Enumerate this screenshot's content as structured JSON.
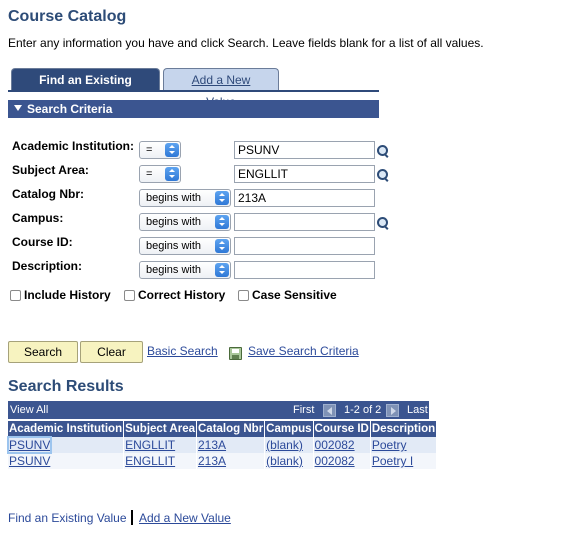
{
  "page": {
    "title": "Course Catalog",
    "instructions": "Enter any information you have and click Search. Leave fields blank for a list of all values."
  },
  "tabs": [
    {
      "label": "Find an Existing Value",
      "active": true
    },
    {
      "label": "Add a New Value",
      "active": false
    }
  ],
  "criteria": {
    "header": "Search Criteria",
    "fields": [
      {
        "label": "Academic Institution:",
        "operator": "=",
        "value": "PSUNV",
        "lookup": true
      },
      {
        "label": "Subject Area:",
        "operator": "=",
        "value": "ENGLLIT",
        "lookup": true
      },
      {
        "label": "Catalog Nbr:",
        "operator": "begins with",
        "value": "213A",
        "lookup": false
      },
      {
        "label": "Campus:",
        "operator": "begins with",
        "value": "",
        "lookup": true
      },
      {
        "label": "Course ID:",
        "operator": "begins with",
        "value": "",
        "lookup": false
      },
      {
        "label": "Description:",
        "operator": "begins with",
        "value": "",
        "lookup": false
      }
    ],
    "checkboxes": [
      {
        "label": "Include History",
        "checked": false
      },
      {
        "label": "Correct History",
        "checked": false
      },
      {
        "label": "Case Sensitive",
        "checked": false
      }
    ]
  },
  "actions": {
    "search": "Search",
    "clear": "Clear",
    "basic_search": "Basic Search",
    "save_search": "Save Search Criteria"
  },
  "results": {
    "title": "Search Results",
    "view_all": "View All",
    "first": "First",
    "range": "1-2 of 2",
    "last": "Last",
    "columns": [
      "Academic Institution",
      "Subject Area",
      "Catalog Nbr",
      "Campus",
      "Course ID",
      "Description"
    ],
    "rows": [
      [
        "PSUNV",
        "ENGLLIT",
        "213A",
        "(blank)",
        "002082",
        "Poetry"
      ],
      [
        "PSUNV",
        "ENGLLIT",
        "213A",
        "(blank)",
        "002082",
        "Poetry I"
      ]
    ]
  },
  "footer": {
    "find_existing": "Find an Existing Value",
    "add_new": "Add a New Value"
  },
  "colors": {
    "header_blue": "#3b5590",
    "title_blue": "#2d4c77",
    "link_blue": "#2c4a9a",
    "button_yellow": "#f7f3c0"
  }
}
